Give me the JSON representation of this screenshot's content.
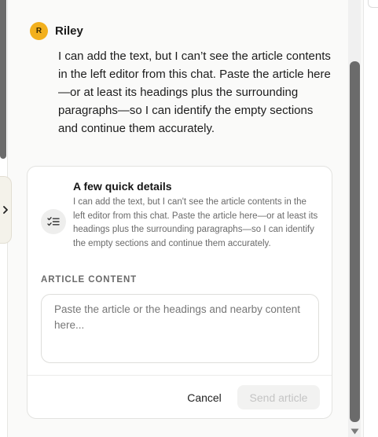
{
  "message": {
    "avatar_initial": "R",
    "avatar_color": "#f2b01e",
    "sender": "Riley",
    "text": "I can add the text, but I can’t see the article contents in the left editor from this chat. Paste the article here—or at least its headings plus the surrounding paragraphs—so I can identify the empty sections and continue them accurately."
  },
  "card": {
    "icon": "checklist-icon",
    "title": "A few quick details",
    "description": "I can add the text, but I can't see the article contents in the left editor from this chat. Paste the article here—or at least its headings plus the surrounding paragraphs—so I can identify the empty sections and continue them accurately.",
    "field_label": "ARTICLE CONTENT",
    "field_value": "",
    "field_placeholder": "Paste the article or the headings and nearby content here...",
    "cancel_label": "Cancel",
    "send_label": "Send article"
  },
  "icons": {
    "collapse_tab": "chevron-right-icon",
    "scroll_down": "triangle-down-icon"
  }
}
